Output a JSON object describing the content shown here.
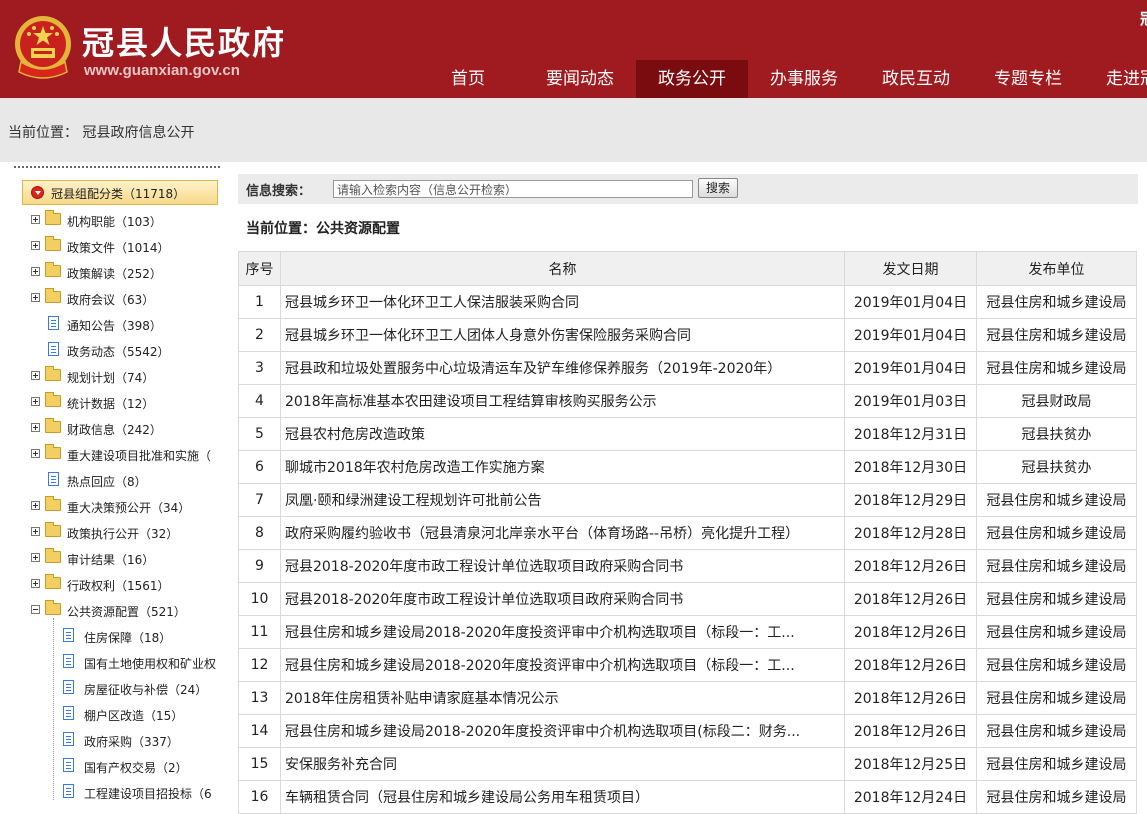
{
  "header": {
    "site_title": "冠县人民政府",
    "site_url": "www.guanxian.gov.cn",
    "brand_color": "#9f1b1f",
    "nav": [
      {
        "label": "首页",
        "active": false
      },
      {
        "label": "要闻动态",
        "active": false
      },
      {
        "label": "政务公开",
        "active": true
      },
      {
        "label": "办事服务",
        "active": false
      },
      {
        "label": "政民互动",
        "active": false
      },
      {
        "label": "专题专栏",
        "active": false
      },
      {
        "label": "走进冠县",
        "active": false
      }
    ],
    "corner_char": "冠"
  },
  "location": {
    "text": "当前位置： 冠县政府信息公开"
  },
  "tree": {
    "root": "冠县组配分类（11718）",
    "items": [
      {
        "label": "机构职能（103）",
        "type": "folder"
      },
      {
        "label": "政策文件（1014）",
        "type": "folder"
      },
      {
        "label": "政策解读（252）",
        "type": "folder"
      },
      {
        "label": "政府会议（63）",
        "type": "folder"
      },
      {
        "label": "通知公告（398）",
        "type": "doc"
      },
      {
        "label": "政务动态（5542）",
        "type": "doc"
      },
      {
        "label": "规划计划（74）",
        "type": "folder"
      },
      {
        "label": "统计数据（12）",
        "type": "folder"
      },
      {
        "label": "财政信息（242）",
        "type": "folder"
      },
      {
        "label": "重大建设项目批准和实施（",
        "type": "folder"
      },
      {
        "label": "热点回应（8）",
        "type": "doc"
      },
      {
        "label": "重大决策预公开（34）",
        "type": "folder"
      },
      {
        "label": "政策执行公开（32）",
        "type": "folder"
      },
      {
        "label": "审计结果（16）",
        "type": "folder"
      },
      {
        "label": "行政权利（1561）",
        "type": "folder"
      },
      {
        "label": "公共资源配置（521）",
        "type": "folder-open"
      }
    ],
    "children": [
      {
        "label": "住房保障（18）"
      },
      {
        "label": "国有土地使用权和矿业权"
      },
      {
        "label": "房屋征收与补偿（24）"
      },
      {
        "label": "棚户区改造（15）"
      },
      {
        "label": "政府采购（337）"
      },
      {
        "label": "国有产权交易（2）"
      },
      {
        "label": "工程建设项目招投标（6"
      }
    ]
  },
  "search": {
    "label": "信息搜索：",
    "placeholder": "请输入检索内容（信息公开检索）",
    "button": "搜索"
  },
  "current_position": "当前位置：公共资源配置",
  "table": {
    "headers": [
      "序号",
      "名称",
      "发文日期",
      "发布单位"
    ],
    "rows": [
      {
        "idx": "1",
        "name": "冠县城乡环卫一体化环卫工人保洁服装采购合同",
        "date": "2019年01月04日",
        "unit": "冠县住房和城乡建设局"
      },
      {
        "idx": "2",
        "name": "冠县城乡环卫一体化环卫工人团体人身意外伤害保险服务采购合同",
        "date": "2019年01月04日",
        "unit": "冠县住房和城乡建设局"
      },
      {
        "idx": "3",
        "name": "冠县政和垃圾处置服务中心垃圾清运车及铲车维修保养服务（2019年-2020年）",
        "date": "2019年01月04日",
        "unit": "冠县住房和城乡建设局"
      },
      {
        "idx": "4",
        "name": "2018年高标准基本农田建设项目工程结算审核购买服务公示",
        "date": "2019年01月03日",
        "unit": "冠县财政局"
      },
      {
        "idx": "5",
        "name": "冠县农村危房改造政策",
        "date": "2018年12月31日",
        "unit": "冠县扶贫办"
      },
      {
        "idx": "6",
        "name": "聊城市2018年农村危房改造工作实施方案",
        "date": "2018年12月30日",
        "unit": "冠县扶贫办"
      },
      {
        "idx": "7",
        "name": "凤凰·颐和绿洲建设工程规划许可批前公告",
        "date": "2018年12月29日",
        "unit": "冠县住房和城乡建设局"
      },
      {
        "idx": "8",
        "name": "政府采购履约验收书（冠县清泉河北岸亲水平台（体育场路--吊桥）亮化提升工程）",
        "date": "2018年12月28日",
        "unit": "冠县住房和城乡建设局"
      },
      {
        "idx": "9",
        "name": "冠县2018-2020年度市政工程设计单位选取项目政府采购合同书",
        "date": "2018年12月26日",
        "unit": "冠县住房和城乡建设局"
      },
      {
        "idx": "10",
        "name": "冠县2018-2020年度市政工程设计单位选取项目政府采购合同书",
        "date": "2018年12月26日",
        "unit": "冠县住房和城乡建设局"
      },
      {
        "idx": "11",
        "name": "冠县住房和城乡建设局2018-2020年度投资评审中介机构选取项目（标段一：工...",
        "date": "2018年12月26日",
        "unit": "冠县住房和城乡建设局"
      },
      {
        "idx": "12",
        "name": "冠县住房和城乡建设局2018-2020年度投资评审中介机构选取项目（标段一：工...",
        "date": "2018年12月26日",
        "unit": "冠县住房和城乡建设局"
      },
      {
        "idx": "13",
        "name": "2018年住房租赁补贴申请家庭基本情况公示",
        "date": "2018年12月26日",
        "unit": "冠县住房和城乡建设局"
      },
      {
        "idx": "14",
        "name": "冠县住房和城乡建设局2018-2020年度投资评审中介机构选取项目(标段二：财务...",
        "date": "2018年12月26日",
        "unit": "冠县住房和城乡建设局"
      },
      {
        "idx": "15",
        "name": "安保服务补充合同",
        "date": "2018年12月25日",
        "unit": "冠县住房和城乡建设局"
      },
      {
        "idx": "16",
        "name": "车辆租赁合同（冠县住房和城乡建设局公务用车租赁项目）",
        "date": "2018年12月24日",
        "unit": "冠县住房和城乡建设局"
      }
    ]
  }
}
